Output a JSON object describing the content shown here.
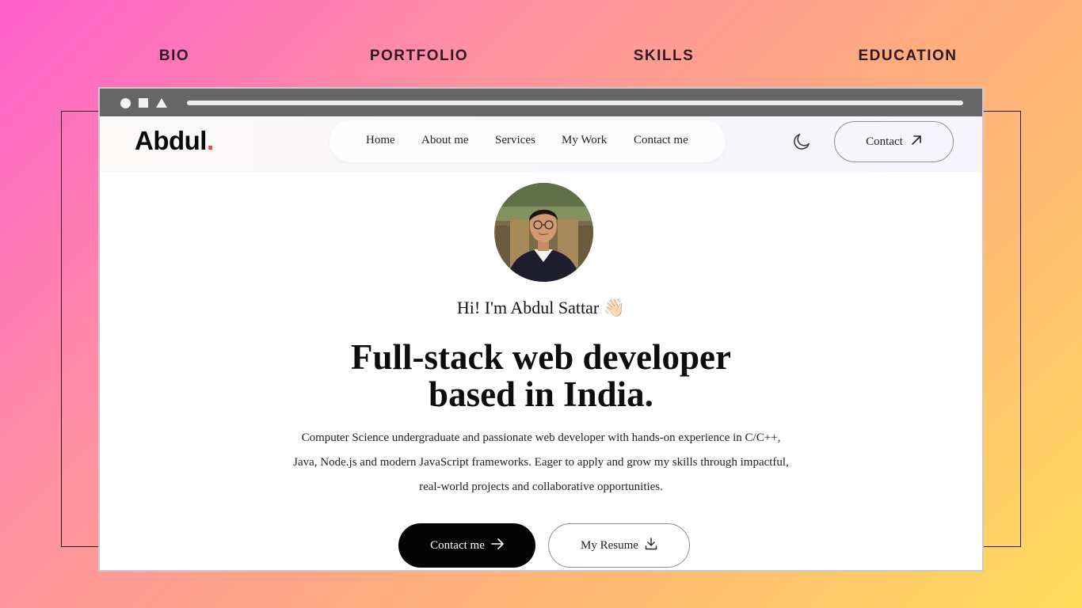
{
  "top_nav": {
    "items": [
      {
        "label": "BIO"
      },
      {
        "label": "PORTFOLIO"
      },
      {
        "label": "SKILLS"
      },
      {
        "label": "EDUCATION"
      }
    ]
  },
  "site": {
    "logo": {
      "text": "Abdul",
      "dot": "."
    },
    "nav": {
      "links": [
        {
          "label": "Home"
        },
        {
          "label": "About me"
        },
        {
          "label": "Services"
        },
        {
          "label": "My Work"
        },
        {
          "label": "Contact me"
        }
      ]
    },
    "header_contact_label": "Contact",
    "hero": {
      "greeting": "Hi! I'm Abdul Sattar 👋🏻",
      "headline_line1": "Full-stack web developer",
      "headline_line2": "based in India.",
      "bio_line1": "Computer Science undergraduate and passionate web developer with hands-on experience in C/C++,",
      "bio_line2": "Java, Node.js and modern JavaScript frameworks. Eager to apply and grow my skills through impactful,",
      "bio_line3": "real-world projects and collaborative opportunities.",
      "primary_button": "Contact me",
      "secondary_button": "My Resume"
    }
  },
  "colors": {
    "accent_dot": "#f0472b",
    "primary_button_bg": "#050505",
    "browser_bar": "#666666"
  },
  "icons": {
    "theme_toggle": "moon-icon",
    "header_contact": "arrow-up-right-icon",
    "primary_button": "arrow-right-icon",
    "secondary_button": "download-icon"
  }
}
